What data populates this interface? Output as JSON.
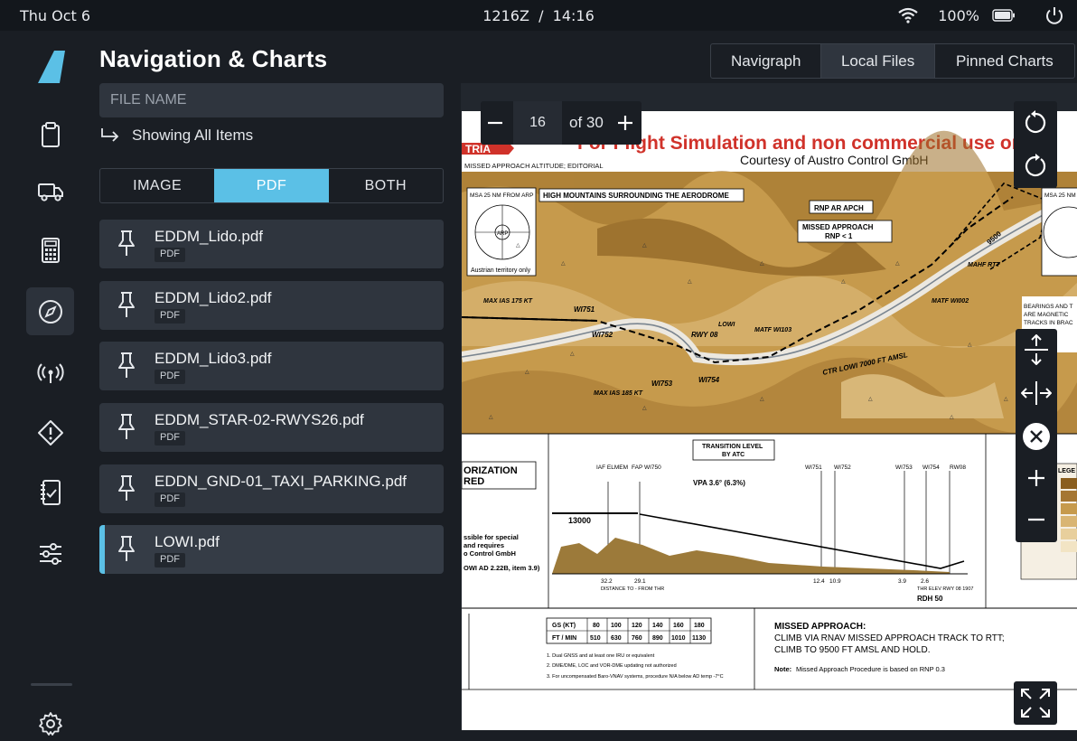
{
  "status_bar": {
    "date": "Thu Oct 6",
    "time": "1216Z  /  14:16",
    "battery": "100%"
  },
  "sidebar": {
    "items": [
      {
        "icon": "clipboard-icon"
      },
      {
        "icon": "truck-icon"
      },
      {
        "icon": "calculator-icon"
      },
      {
        "icon": "compass-icon",
        "active": true
      },
      {
        "icon": "radio-tower-icon"
      },
      {
        "icon": "warning-icon"
      },
      {
        "icon": "checklist-icon"
      },
      {
        "icon": "sliders-icon"
      }
    ],
    "settings_icon": "gear-icon"
  },
  "panel": {
    "title": "Navigation & Charts",
    "search_placeholder": "FILE NAME",
    "showing_label": "Showing All Items",
    "filter": {
      "options": [
        "IMAGE",
        "PDF",
        "BOTH"
      ],
      "selected": "PDF"
    },
    "files": [
      {
        "name": "EDDM_Lido.pdf",
        "type": "PDF"
      },
      {
        "name": "EDDM_Lido2.pdf",
        "type": "PDF"
      },
      {
        "name": "EDDM_Lido3.pdf",
        "type": "PDF"
      },
      {
        "name": "EDDM_STAR-02-RWYS26.pdf",
        "type": "PDF"
      },
      {
        "name": "EDDN_GND-01_TAXI_PARKING.pdf",
        "type": "PDF"
      },
      {
        "name": "LOWI.pdf",
        "type": "PDF",
        "selected": true
      }
    ]
  },
  "source_tabs": {
    "items": [
      "Navigraph",
      "Local Files",
      "Pinned Charts"
    ],
    "selected": "Local Files"
  },
  "viewer": {
    "page": "16",
    "of_label": "of 30",
    "chart": {
      "header_red": "For Flight Simulation and non commercial use only",
      "header_sub": "Courtesy of Austro Control GmbH",
      "header_country": "TRIA",
      "missed_alt_note": "MISSED APPROACH ALTITUDE; EDITORIAL",
      "msa_left": "MSA 25 NM FROM ARP",
      "msa_right": "MSA 25 NM",
      "austrian_territory": "Austrian territory only",
      "high_mountains": "HIGH MOUNTAINS SURROUNDING THE AERODROME",
      "rnp_box": "RNP AR APCH",
      "missed_box_1": "MISSED APPROACH",
      "missed_box_2": "RNP < 1",
      "bearings_1": "BEARINGS AND T",
      "bearings_2": "ARE MAGNETIC",
      "tracks_1": "TRACKS IN BRAC",
      "max_ias_175": "MAX IAS 175 KT",
      "max_ias_185": "MAX IAS 185 KT",
      "ctr_lowi": "CTR LOWI 7000 FT AMSL",
      "fixes": [
        "WI751",
        "WI752",
        "WI753",
        "WI754",
        "RWY 08",
        "LOWI",
        "MATF WI103",
        "MATF WI002",
        "MAHF RTT",
        "9500"
      ],
      "transition_1": "TRANSITION LEVEL",
      "transition_2": "BY ATC",
      "authorization_1": "ORIZATION",
      "authorization_2": "RED",
      "vpa": "VPA 3.6° (6.3%)",
      "alt_13000": "13000",
      "profile_fixes": [
        "IAF ELMEM",
        "FAP WI750",
        "WI751",
        "WI752",
        "WI753",
        "WI754",
        "RW08"
      ],
      "distances": [
        "32.2",
        "29.1",
        "12.4",
        "10.9",
        "3.9",
        "2.6"
      ],
      "distance_label": "DISTANCE TO - FROM THR",
      "thr_elev": "THR ELEV RWY 08 1907",
      "rdh": "RDH 50",
      "special_1": "ssible for special",
      "special_2": "and requires",
      "special_3": "o Control GmbH",
      "lowi_ad": "OWI AD 2.22B, item 3.9)",
      "gs_table": {
        "row1": [
          "GS (KT)",
          "80",
          "100",
          "120",
          "140",
          "160",
          "180"
        ],
        "row2": [
          "FT / MIN",
          "510",
          "630",
          "760",
          "890",
          "1010",
          "1130"
        ]
      },
      "notes": [
        "1. Dual GNSS and at least one IRU or equivalent",
        "2. DME/DME, LOC and VOR-DME updating not authorized",
        "3. For uncompensated Baro-VNAV systems, procedure N/A below AD temp -7°C"
      ],
      "missed_title": "MISSED APPROACH:",
      "missed_line1": "CLIMB VIA RNAV MISSED APPROACH TRACK TO RTT;",
      "missed_line2": "CLIMB TO 9500 FT AMSL AND HOLD.",
      "missed_note_label": "Note:",
      "missed_note": "Missed Approach Procedure is based on RNP 0.3",
      "legend_label": "LEGE"
    }
  },
  "colors": {
    "accent": "#5bc0e6",
    "background": "#1a1e24",
    "card": "#2f353e",
    "chart_red": "#d0322a",
    "terrain": "#c69a4c"
  }
}
